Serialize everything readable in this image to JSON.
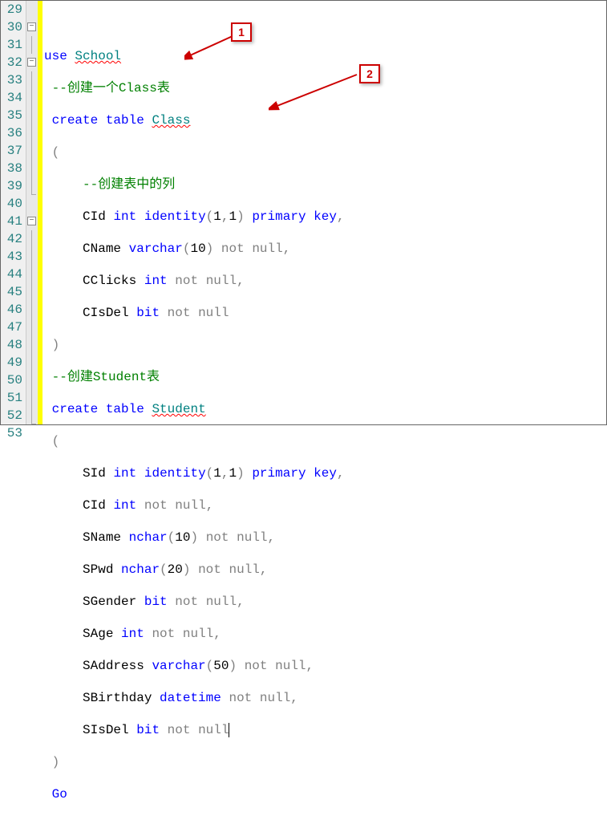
{
  "lines": [
    {
      "n": 29,
      "fold": null
    },
    {
      "n": 30,
      "fold": "box"
    },
    {
      "n": 31,
      "fold": "line"
    },
    {
      "n": 32,
      "fold": "box"
    },
    {
      "n": 33,
      "fold": "line"
    },
    {
      "n": 34,
      "fold": "line"
    },
    {
      "n": 35,
      "fold": "line"
    },
    {
      "n": 36,
      "fold": "line"
    },
    {
      "n": 37,
      "fold": "line"
    },
    {
      "n": 38,
      "fold": "line"
    },
    {
      "n": 39,
      "fold": "end"
    },
    {
      "n": 40,
      "fold": null
    },
    {
      "n": 41,
      "fold": "box"
    },
    {
      "n": 42,
      "fold": "line"
    },
    {
      "n": 43,
      "fold": "line"
    },
    {
      "n": 44,
      "fold": "line"
    },
    {
      "n": 45,
      "fold": "line"
    },
    {
      "n": 46,
      "fold": "line"
    },
    {
      "n": 47,
      "fold": "line"
    },
    {
      "n": 48,
      "fold": "line"
    },
    {
      "n": 49,
      "fold": "line"
    },
    {
      "n": 50,
      "fold": "line"
    },
    {
      "n": 51,
      "fold": "line"
    },
    {
      "n": 52,
      "fold": "end"
    },
    {
      "n": 53,
      "fold": null
    }
  ],
  "code": {
    "l30_use": "use",
    "l30_school": "School",
    "l31": "--创建一个Class表",
    "l32_create": "create",
    "l32_table": "table",
    "l32_class": "Class",
    "l33": "(",
    "l34": "--创建表中的列",
    "l35_cid": "CId",
    "l35_int": "int",
    "l35_identity": "identity",
    "l35_paren": "(",
    "l35_1a": "1",
    "l35_c": ",",
    "l35_1b": "1",
    "l35_paren2": ")",
    "l35_primary": "primary",
    "l35_key": "key",
    "l35_comma": ",",
    "l36_cname": "CName",
    "l36_varchar": "varchar",
    "l36_p1": "(",
    "l36_10": "10",
    "l36_p2": ")",
    "l36_not": "not",
    "l36_null": "null",
    "l36_c": ",",
    "l37_cclicks": "CClicks",
    "l37_int": "int",
    "l37_not": "not",
    "l37_null": "null",
    "l37_c": ",",
    "l38_cisdel": "CIsDel",
    "l38_bit": "bit",
    "l38_not": "not",
    "l38_null": "null",
    "l39": ")",
    "l40": "--创建Student表",
    "l41_create": "create",
    "l41_table": "table",
    "l41_student": "Student",
    "l42": "(",
    "l43_sid": "SId",
    "l43_int": "int",
    "l43_identity": "identity",
    "l43_p1": "(",
    "l43_1a": "1",
    "l43_c": ",",
    "l43_1b": "1",
    "l43_p2": ")",
    "l43_primary": "primary",
    "l43_key": "key",
    "l43_comma": ",",
    "l44_cid": "CId",
    "l44_int": "int",
    "l44_not": "not",
    "l44_null": "null",
    "l44_c": ",",
    "l45_sname": "SName",
    "l45_nchar": "nchar",
    "l45_p1": "(",
    "l45_10": "10",
    "l45_p2": ")",
    "l45_not": "not",
    "l45_null": "null",
    "l45_c": ",",
    "l46_spwd": "SPwd",
    "l46_nchar": "nchar",
    "l46_p1": "(",
    "l46_20": "20",
    "l46_p2": ")",
    "l46_not": "not",
    "l46_null": "null",
    "l46_c": ",",
    "l47_sgender": "SGender",
    "l47_bit": "bit",
    "l47_not": "not",
    "l47_null": "null",
    "l47_c": ",",
    "l48_sage": "SAge",
    "l48_int": "int",
    "l48_not": "not",
    "l48_null": "null",
    "l48_c": ",",
    "l49_saddress": "SAddress",
    "l49_varchar": "varchar",
    "l49_p1": "(",
    "l49_50": "50",
    "l49_p2": ")",
    "l49_not": "not",
    "l49_null": "null",
    "l49_c": ",",
    "l50_sbirthday": "SBirthday",
    "l50_datetime": "datetime",
    "l50_not": "not",
    "l50_null": "null",
    "l50_c": ",",
    "l51_sisdel": "SIsDel",
    "l51_bit": "bit",
    "l51_not": "not",
    "l51_null": "null",
    "l52": ")",
    "l53": "Go"
  },
  "callouts": {
    "one": "1",
    "two": "2"
  }
}
